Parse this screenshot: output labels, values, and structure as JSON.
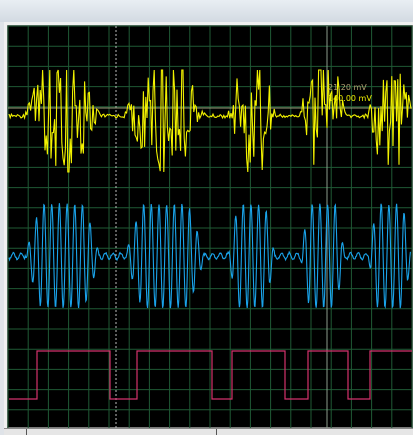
{
  "readouts": {
    "ch1_delta": "21.20 mV",
    "ch1_level": "140.00 mV"
  },
  "colors": {
    "background": "#000000",
    "grid": "#1f5a35",
    "channel1": "#f2f200",
    "channel2": "#1aa3ea",
    "channel3": "#d4326c",
    "cursor_solid": "#8c9c8c",
    "cursor_dashed": "#bcbcbc"
  }
}
